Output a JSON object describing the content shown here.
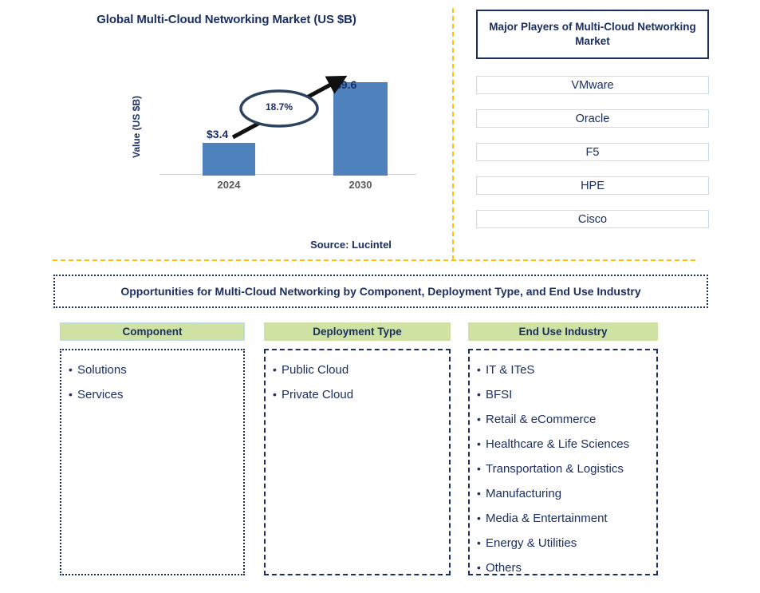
{
  "chart_panel": {
    "title": "Global Multi-Cloud Networking Market (US $B)",
    "y_axis_label": "Value (US $B)",
    "source": "Source: Lucintel"
  },
  "chart_data": {
    "type": "bar",
    "title": "Global Multi-Cloud Networking Market (US $B)",
    "categories": [
      "2024",
      "2030"
    ],
    "values": [
      3.4,
      9.6
    ],
    "value_labels": [
      "$3.4",
      "$9.6"
    ],
    "xlabel": "",
    "ylabel": "Value (US $B)",
    "ylim": [
      0,
      10.5
    ],
    "grid": false,
    "legend": "none",
    "bar_color": "#4f81bd",
    "annotation": {
      "text": "18.7%",
      "shape": "ellipse-with-arrow",
      "meaning": "CAGR from 2024 to 2030"
    },
    "source": "Source: Lucintel"
  },
  "players": {
    "header": "Major Players of Multi-Cloud Networking Market",
    "items": [
      {
        "name": "VMware"
      },
      {
        "name": "Oracle"
      },
      {
        "name": "F5"
      },
      {
        "name": "HPE"
      },
      {
        "name": "Cisco"
      }
    ]
  },
  "opportunities": {
    "banner": "Opportunities for Multi-Cloud Networking by Component, Deployment Type, and End Use Industry",
    "columns": [
      {
        "header": "Component",
        "items": [
          "Solutions",
          "Services"
        ]
      },
      {
        "header": "Deployment Type",
        "items": [
          "Public Cloud",
          "Private Cloud"
        ]
      },
      {
        "header": "End Use Industry",
        "items": [
          "IT & ITeS",
          "BFSI",
          "Retail & eCommerce",
          "Healthcare & Life Sciences",
          "Transportation & Logistics",
          "Manufacturing",
          "Media & Entertainment",
          "Energy & Utilities",
          "Others"
        ]
      }
    ]
  },
  "colors": {
    "navy": "#1b2f63",
    "bar_blue": "#4f81bd",
    "divider_gold": "#ffc20e",
    "header_green": "#cfe2a3",
    "player_border": "#c5dcec"
  }
}
